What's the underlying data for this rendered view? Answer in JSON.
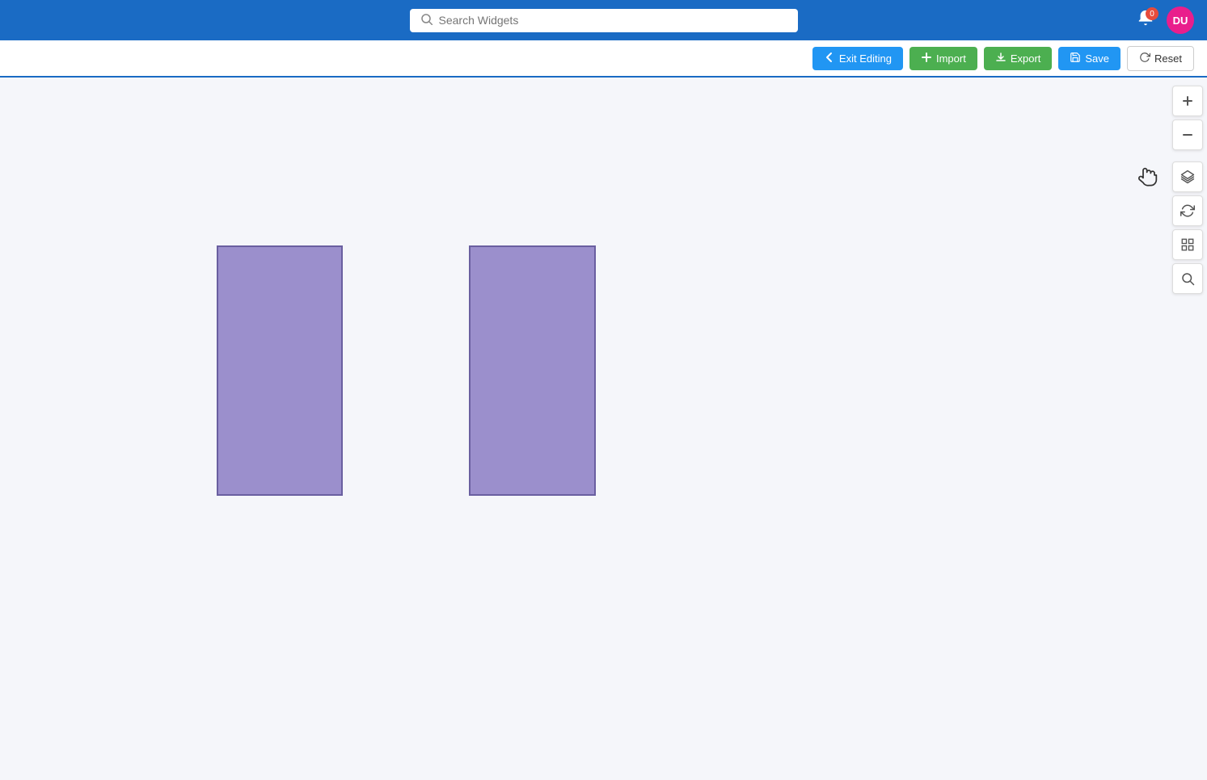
{
  "navbar": {
    "search_placeholder": "Search Widgets",
    "notification_count": "0",
    "avatar_initials": "DU"
  },
  "toolbar": {
    "exit_editing_label": "Exit Editing",
    "import_label": "Import",
    "export_label": "Export",
    "save_label": "Save",
    "reset_label": "Reset"
  },
  "side_toolbar": {
    "zoom_in_label": "+",
    "zoom_out_label": "−",
    "layers_label": "⊞",
    "refresh_label": "↻",
    "grid_label": "⊞",
    "search_label": "🔍"
  },
  "canvas": {
    "widget1": {
      "color": "#9b8fcc"
    },
    "widget2": {
      "color": "#9b8fcc"
    }
  },
  "icons": {
    "search": "🔍",
    "arrow_left": "←",
    "plus": "+",
    "download": "⬇",
    "save_disk": "💾",
    "reset": "↻",
    "layers": "◈",
    "grid": "⊞",
    "hand": "✋",
    "bell": "🔔"
  }
}
